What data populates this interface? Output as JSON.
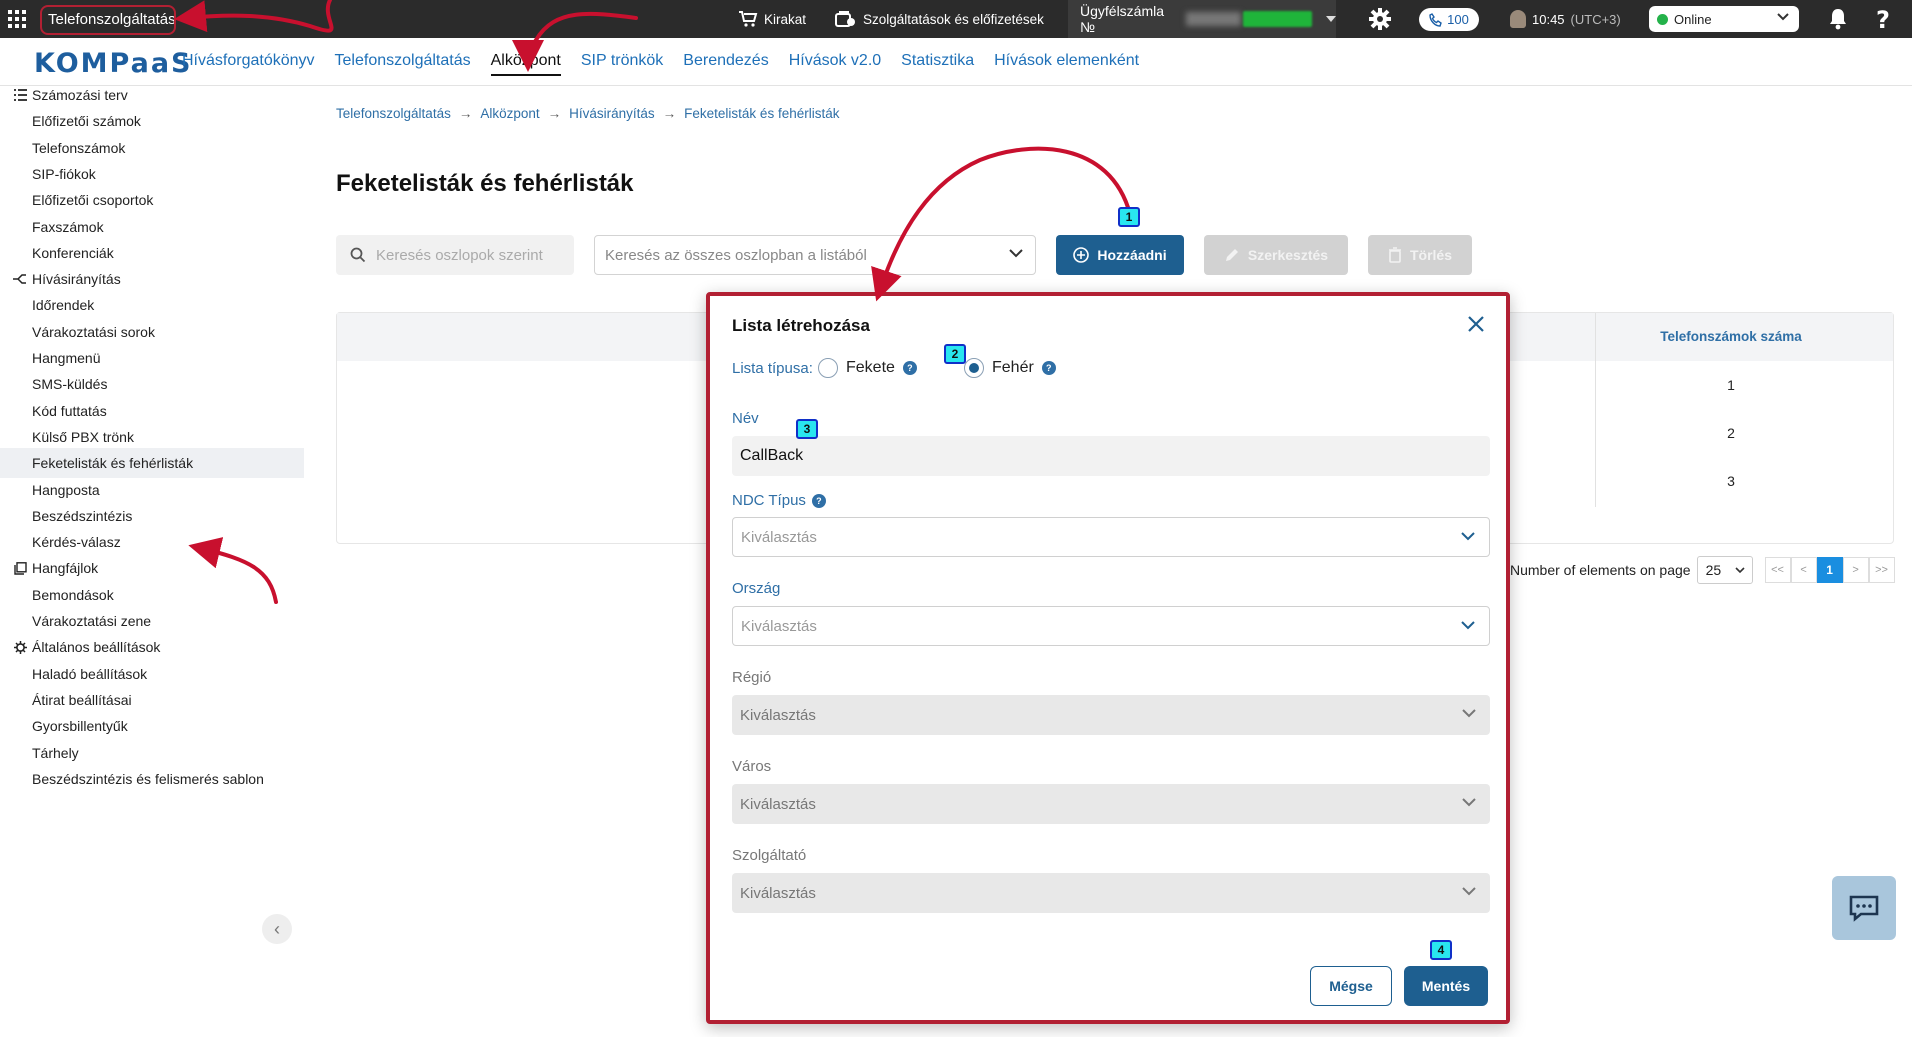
{
  "topbar": {
    "app_title": "Telefonszolgáltatás",
    "showcase": "Kirakat",
    "services": "Szolgáltatások és előfizetések",
    "account_label": "Ügyfélszámla №",
    "calls_count": "100",
    "time": "10:45",
    "timezone": "(UTC+3)",
    "status": "Online",
    "status_color": "#24b24a"
  },
  "logo": "KOMPaaS",
  "nav": [
    "Hívásforgatókönyv",
    "Telefonszolgáltatás",
    "Alközpont",
    "SIP trönkök",
    "Berendezés",
    "Hívások v2.0",
    "Statisztika",
    "Hívások elemenként"
  ],
  "nav_active": "Alközpont",
  "sidebar": {
    "sections": [
      {
        "label": "Számozási terv",
        "icon": "list-icon",
        "items": [
          "Előfizetői számok",
          "Telefonszámok",
          "SIP-fiókok",
          "Előfizetői csoportok",
          "Faxszámok",
          "Konferenciák"
        ]
      },
      {
        "label": "Hívásirányítás",
        "icon": "routing-icon",
        "items": [
          "Időrendek",
          "Várakoztatási sorok",
          "Hangmenü",
          "SMS-küldés",
          "Kód futtatás",
          "Külső PBX trönk",
          "Feketelisták és fehérlisták",
          "Hangposta",
          "Beszédszintézis",
          "Kérdés-válasz"
        ]
      },
      {
        "label": "Hangfájlok",
        "icon": "audio-files-icon",
        "items": [
          "Bemondások",
          "Várakoztatási zene"
        ]
      },
      {
        "label": "Általános beállítások",
        "icon": "gear-icon",
        "items": [
          "Haladó beállítások",
          "Átirat beállításai",
          "Gyorsbillentyűk",
          "Tárhely",
          "Beszédszintézis és felismerés sablon"
        ]
      }
    ],
    "selected": "Feketelisták és fehérlisták"
  },
  "breadcrumb": [
    "Telefonszolgáltatás",
    "Alközpont",
    "Hívásirányítás",
    "Feketelisták és fehérlisták"
  ],
  "page_title": "Feketelisták és fehérlisták",
  "toolbar": {
    "search_columns_placeholder": "Keresés oszlopok szerint",
    "search_all_placeholder": "Keresés az összes oszlopban a listából",
    "add_label": "Hozzáadni",
    "edit_label": "Szerkesztés",
    "delete_label": "Törlés"
  },
  "table": {
    "header_phones": "Telefonszámok száma",
    "rows": [
      "1",
      "2",
      "3"
    ]
  },
  "pager": {
    "label": "Number of elements on page",
    "page_size": "25",
    "first": "<<",
    "prev": "<",
    "current": "1",
    "next": ">",
    "last": ">>"
  },
  "modal": {
    "title": "Lista létrehozása",
    "type_label": "Lista típusa:",
    "option_black": "Fekete",
    "option_white": "Fehér",
    "selected_type": "Fehér",
    "name_label": "Név",
    "name_value": "CallBack",
    "ndc_label": "NDC Típus",
    "ndc_placeholder": "Kiválasztás",
    "country_label": "Ország",
    "country_placeholder": "Kiválasztás",
    "region_label": "Régió",
    "region_placeholder": "Kiválasztás",
    "city_label": "Város",
    "city_placeholder": "Kiválasztás",
    "provider_label": "Szolgáltató",
    "provider_placeholder": "Kiválasztás",
    "cancel_label": "Mégse",
    "save_label": "Mentés"
  },
  "steps": [
    "1",
    "2",
    "3",
    "4"
  ],
  "colors": {
    "primary": "#1e5f90",
    "link": "#2f6fa6",
    "annotation_red": "#b22033",
    "step_marker": "#29e6ef"
  }
}
